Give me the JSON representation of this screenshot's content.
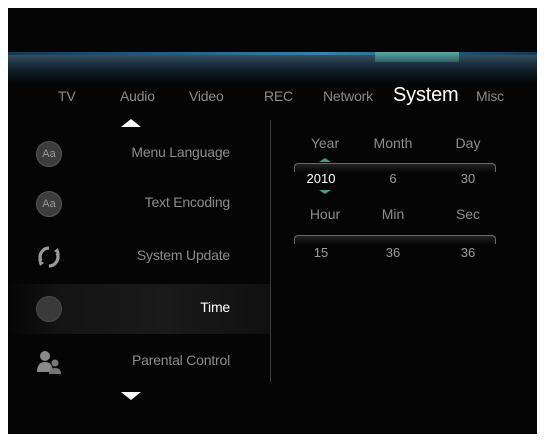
{
  "tabs": [
    {
      "label": "TV"
    },
    {
      "label": "Audio"
    },
    {
      "label": "Video"
    },
    {
      "label": "REC"
    },
    {
      "label": "Network"
    },
    {
      "label": "System",
      "active": true
    },
    {
      "label": "Misc"
    }
  ],
  "menu": [
    {
      "label": "Menu Language",
      "icon": "font-aa-icon"
    },
    {
      "label": "Text Encoding",
      "icon": "font-aa-icon"
    },
    {
      "label": "System Update",
      "icon": "refresh-icon"
    },
    {
      "label": "Time",
      "icon": "clock-icon",
      "selected": true
    },
    {
      "label": "Parental Control",
      "icon": "parental-users-icon"
    }
  ],
  "time": {
    "date_headers": [
      "Year",
      "Month",
      "Day"
    ],
    "date_values": [
      "2010",
      "6",
      "30"
    ],
    "time_headers": [
      "Hour",
      "Min",
      "Sec"
    ],
    "time_values": [
      "15",
      "36",
      "36"
    ]
  },
  "colors": {
    "background": "#050505",
    "accent_bar": "#2b88b8",
    "tab_highlight": "#5ea8a8",
    "spin_arrow": "#3fa07a",
    "text_dim": "#8c8c8c",
    "text_active": "#ffffff"
  }
}
